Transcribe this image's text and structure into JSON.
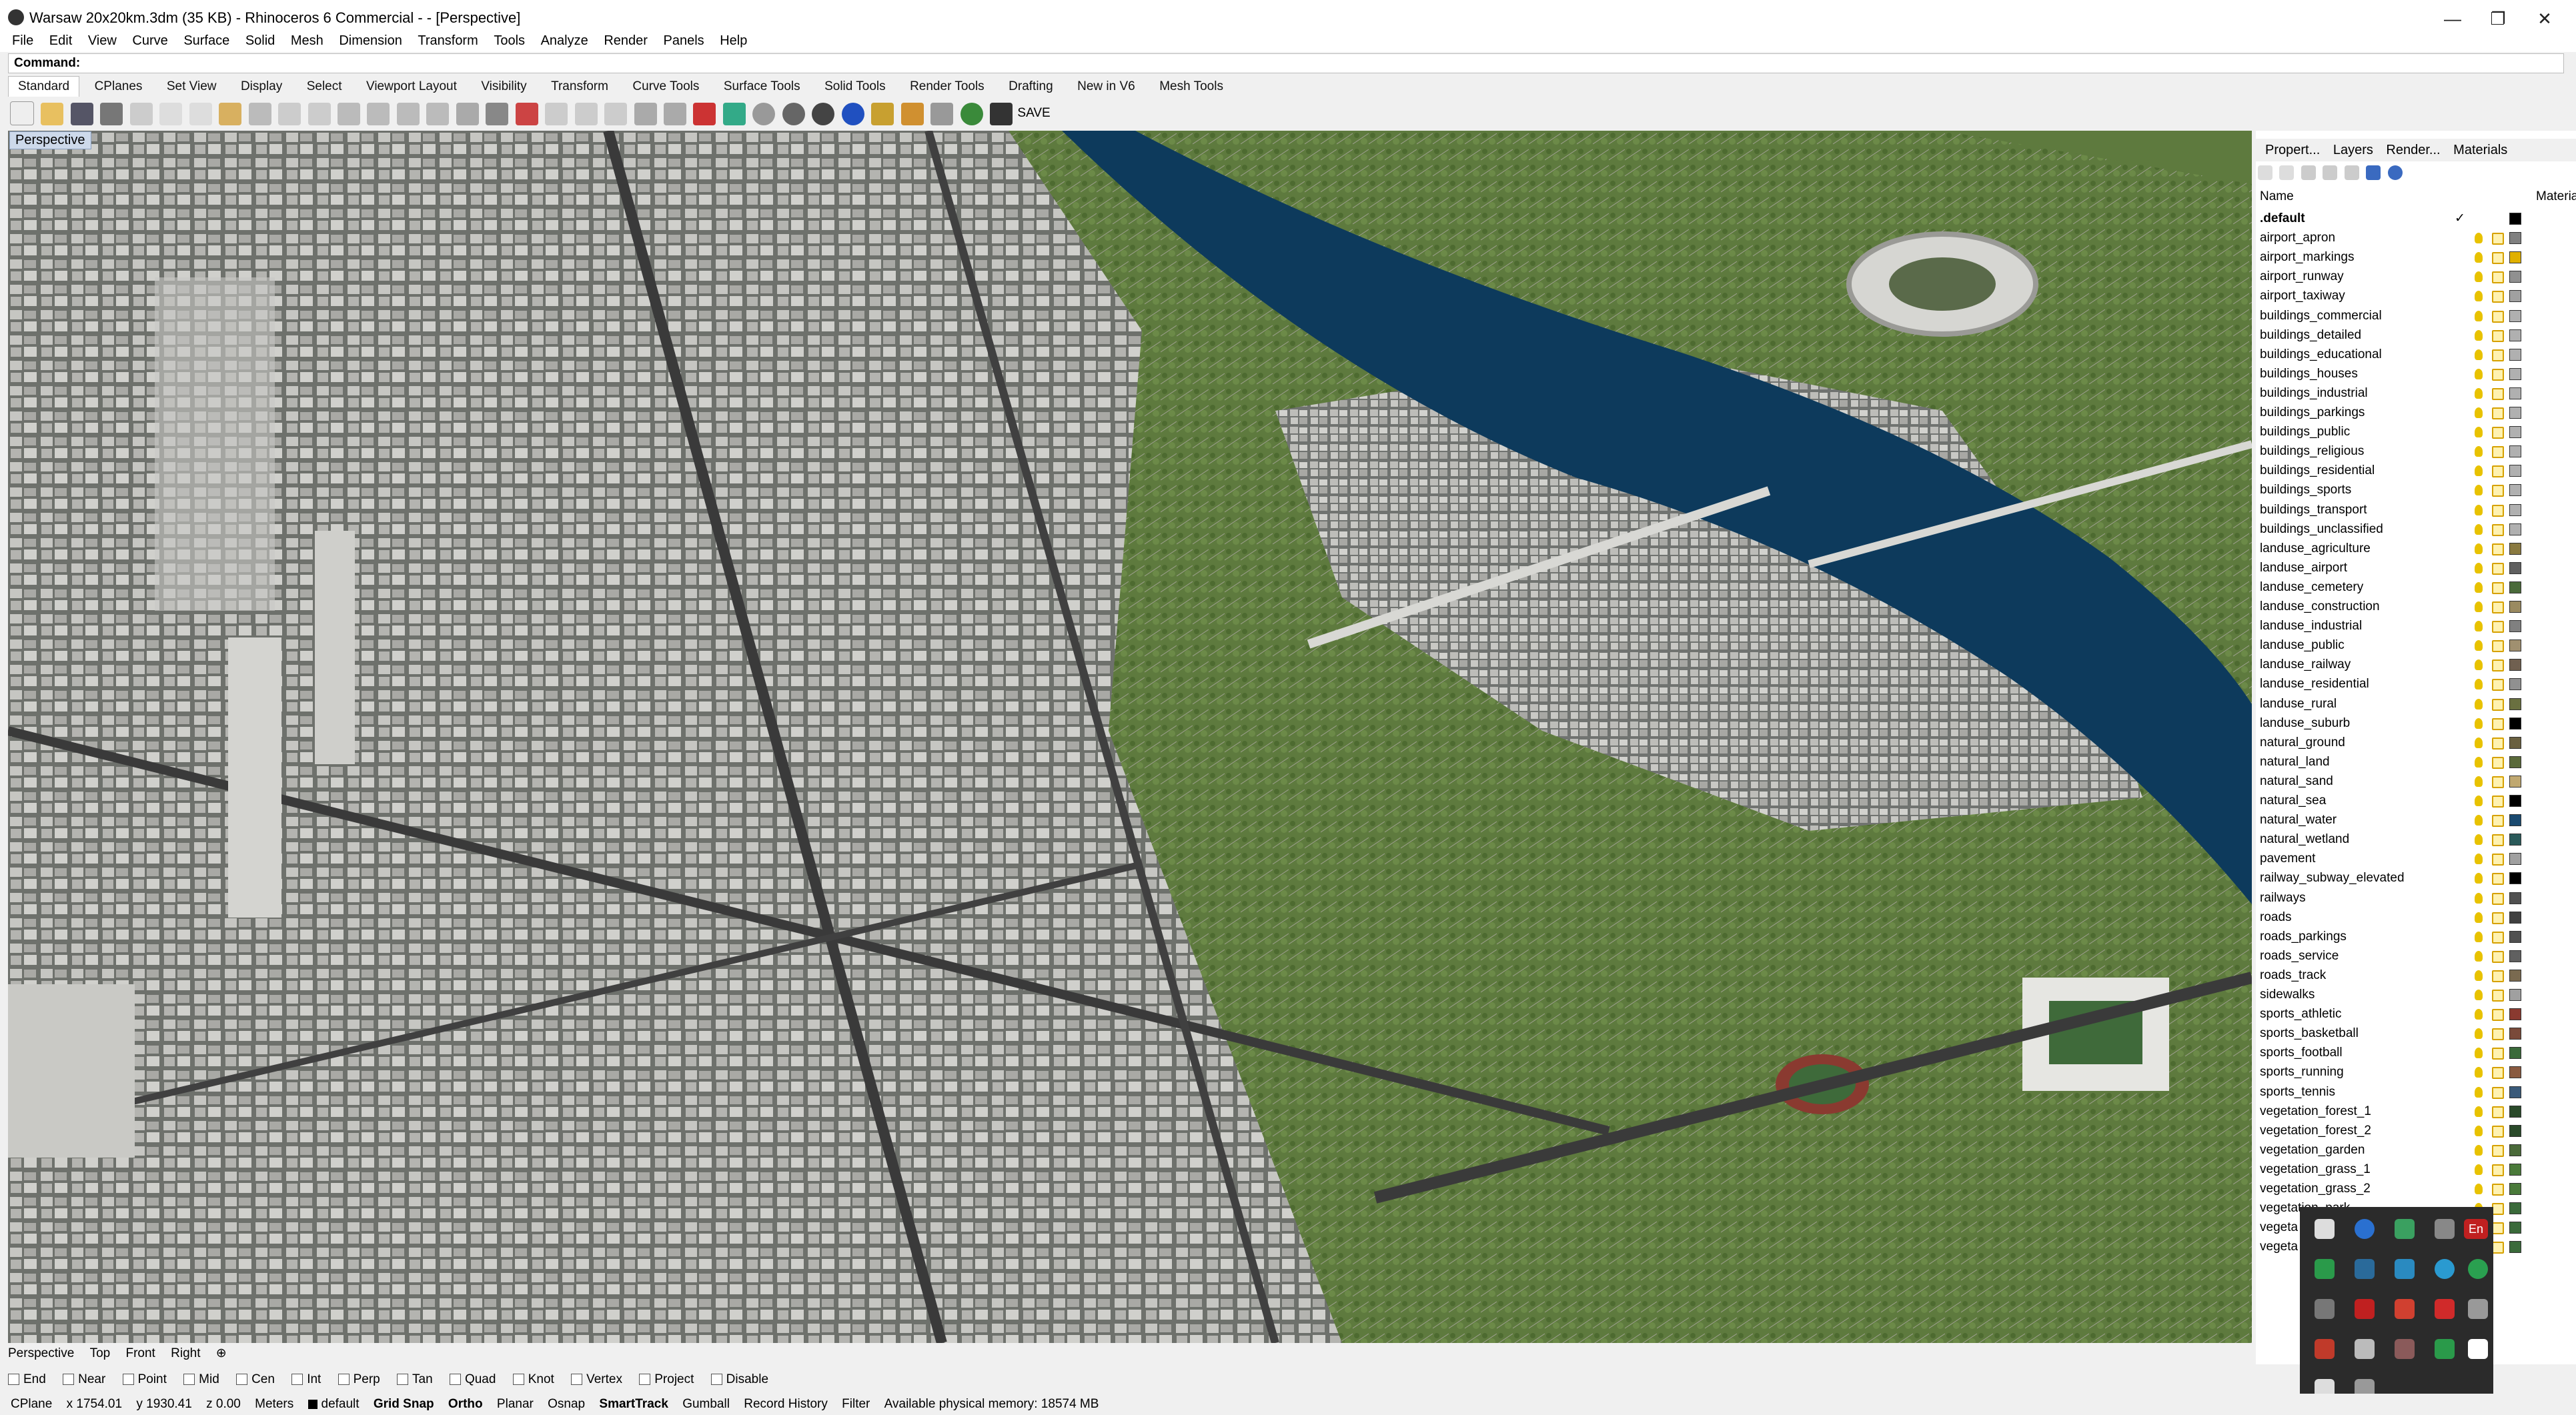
{
  "window": {
    "title": "Warsaw 20x20km.3dm (35 KB) - Rhinoceros 6 Commercial - - [Perspective]",
    "minimize": "—",
    "restore": "❐",
    "close": "✕"
  },
  "menu": [
    "File",
    "Edit",
    "View",
    "Curve",
    "Surface",
    "Solid",
    "Mesh",
    "Dimension",
    "Transform",
    "Tools",
    "Analyze",
    "Render",
    "Panels",
    "Help"
  ],
  "command": {
    "label": "Command:"
  },
  "tabs": [
    "Standard",
    "CPlanes",
    "Set View",
    "Display",
    "Select",
    "Viewport Layout",
    "Visibility",
    "Transform",
    "Curve Tools",
    "Surface Tools",
    "Solid Tools",
    "Render Tools",
    "Drafting",
    "New in V6",
    "Mesh Tools"
  ],
  "toolbar": {
    "save_label": "SAVE"
  },
  "viewport": {
    "label": "Perspective"
  },
  "panel": {
    "tabs": [
      "Propert...",
      "Layers",
      "Render...",
      "Materials"
    ],
    "col_name": "Name",
    "col_material": "Materia"
  },
  "layers": [
    {
      "name": ".default",
      "color": "#000000"
    },
    {
      "name": "airport_apron",
      "color": "#808080"
    },
    {
      "name": "airport_markings",
      "color": "#e0b000"
    },
    {
      "name": "airport_runway",
      "color": "#909090"
    },
    {
      "name": "airport_taxiway",
      "color": "#a0a0a0"
    },
    {
      "name": "buildings_commercial",
      "color": "#b0b0b0"
    },
    {
      "name": "buildings_detailed",
      "color": "#b0b0b0"
    },
    {
      "name": "buildings_educational",
      "color": "#b0b0b0"
    },
    {
      "name": "buildings_houses",
      "color": "#b0b0b0"
    },
    {
      "name": "buildings_industrial",
      "color": "#b0b0b0"
    },
    {
      "name": "buildings_parkings",
      "color": "#b0b0b0"
    },
    {
      "name": "buildings_public",
      "color": "#b0b0b0"
    },
    {
      "name": "buildings_religious",
      "color": "#b0b0b0"
    },
    {
      "name": "buildings_residential",
      "color": "#b0b0b0"
    },
    {
      "name": "buildings_sports",
      "color": "#b0b0b0"
    },
    {
      "name": "buildings_transport",
      "color": "#b0b0b0"
    },
    {
      "name": "buildings_unclassified",
      "color": "#b0b0b0"
    },
    {
      "name": "landuse_agriculture",
      "color": "#8a7a40"
    },
    {
      "name": "landuse_airport",
      "color": "#606060"
    },
    {
      "name": "landuse_cemetery",
      "color": "#4a6a3a"
    },
    {
      "name": "landuse_construction",
      "color": "#9a8a60"
    },
    {
      "name": "landuse_industrial",
      "color": "#808080"
    },
    {
      "name": "landuse_public",
      "color": "#a09070"
    },
    {
      "name": "landuse_railway",
      "color": "#706050"
    },
    {
      "name": "landuse_residential",
      "color": "#909090"
    },
    {
      "name": "landuse_rural",
      "color": "#6a7040"
    },
    {
      "name": "landuse_suburb",
      "color": "#000000"
    },
    {
      "name": "natural_ground",
      "color": "#6a6040"
    },
    {
      "name": "natural_land",
      "color": "#5a6a3a"
    },
    {
      "name": "natural_sand",
      "color": "#c0a870"
    },
    {
      "name": "natural_sea",
      "color": "#000000"
    },
    {
      "name": "natural_water",
      "color": "#1a4a70"
    },
    {
      "name": "natural_wetland",
      "color": "#2a5a5a"
    },
    {
      "name": "pavement",
      "color": "#a0a0a0"
    },
    {
      "name": "railway_subway_elevated",
      "color": "#000000"
    },
    {
      "name": "railways",
      "color": "#505050"
    },
    {
      "name": "roads",
      "color": "#404040"
    },
    {
      "name": "roads_parkings",
      "color": "#505050"
    },
    {
      "name": "roads_service",
      "color": "#606060"
    },
    {
      "name": "roads_track",
      "color": "#7a6a50"
    },
    {
      "name": "sidewalks",
      "color": "#a0a0a0"
    },
    {
      "name": "sports_athletic",
      "color": "#8a3a30"
    },
    {
      "name": "sports_basketball",
      "color": "#7a4a3a"
    },
    {
      "name": "sports_football",
      "color": "#3a6a3a"
    },
    {
      "name": "sports_running",
      "color": "#8a5a40"
    },
    {
      "name": "sports_tennis",
      "color": "#3a5a7a"
    },
    {
      "name": "vegetation_forest_1",
      "color": "#2a4a2a"
    },
    {
      "name": "vegetation_forest_2",
      "color": "#2a4a2a"
    },
    {
      "name": "vegetation_garden",
      "color": "#4a6a3a"
    },
    {
      "name": "vegetation_grass_1",
      "color": "#4a7a3a"
    },
    {
      "name": "vegetation_grass_2",
      "color": "#4a7a3a"
    },
    {
      "name": "vegetation_park",
      "color": "#3a6a3a"
    },
    {
      "name": "vegeta",
      "color": "#3a6a3a"
    },
    {
      "name": "vegeta",
      "color": "#3a6a3a"
    }
  ],
  "viewport_tabs": [
    "Perspective",
    "Top",
    "Front",
    "Right"
  ],
  "osnap": [
    "End",
    "Near",
    "Point",
    "Mid",
    "Cen",
    "Int",
    "Perp",
    "Tan",
    "Quad",
    "Knot",
    "Vertex",
    "Project",
    "Disable"
  ],
  "status": {
    "cplane": "CPlane",
    "x": "x 1754.01",
    "y": "y 1930.41",
    "z": "z 0.00",
    "units": "Meters",
    "layer": "default",
    "items": [
      "Grid Snap",
      "Ortho",
      "Planar",
      "Osnap",
      "SmartTrack",
      "Gumball",
      "Record History",
      "Filter"
    ],
    "memory": "Available physical memory: 18574 MB"
  },
  "tray": {
    "lang": "En"
  }
}
